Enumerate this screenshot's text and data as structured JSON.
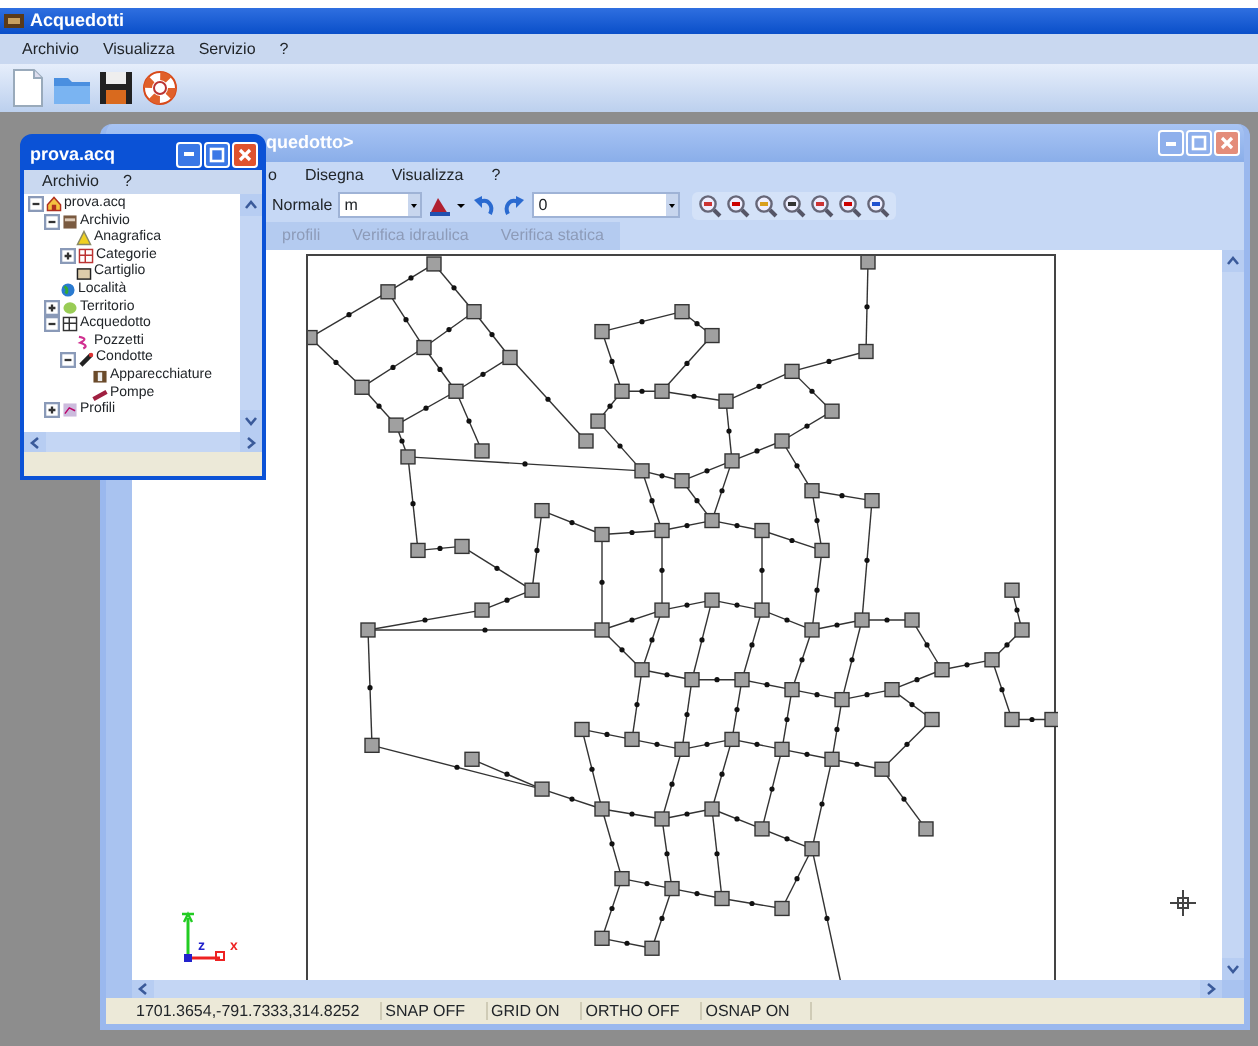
{
  "app": {
    "title": "Acquedotti",
    "menu": [
      "Archivio",
      "Visualizza",
      "Servizio",
      "?"
    ]
  },
  "project_window": {
    "title": "prova.acq",
    "menu": [
      "Archivio",
      "?"
    ],
    "tree": [
      {
        "label": "prova.acq",
        "expanded": true,
        "children": [
          {
            "label": "Archivio",
            "expanded": true,
            "children": [
              {
                "label": "Anagrafica"
              },
              {
                "label": "Categorie",
                "expanded": false
              },
              {
                "label": "Cartiglio"
              }
            ]
          },
          {
            "label": "Località"
          },
          {
            "label": "Territorio",
            "expanded": false
          },
          {
            "label": "Acquedotto",
            "expanded": true,
            "children": [
              {
                "label": "Pozzetti"
              },
              {
                "label": "Condotte",
                "expanded": true,
                "children": [
                  {
                    "label": "Apparecchiature"
                  },
                  {
                    "label": "Pompe"
                  }
                ]
              }
            ]
          },
          {
            "label": "Profili",
            "expanded": false
          }
        ]
      }
    ]
  },
  "drawing_window": {
    "title": "quedotto>",
    "menu": [
      "o",
      "Disegna",
      "Visualizza",
      "?"
    ],
    "toolbar": {
      "style_label": "Normale",
      "unit_value": "m",
      "layer_value": "0"
    },
    "tabs": [
      {
        "label": "profili",
        "disabled": true
      },
      {
        "label": "Verifica idraulica",
        "disabled": true
      },
      {
        "label": "Verifica statica",
        "disabled": true
      }
    ],
    "axis_labels": [
      "z",
      "x"
    ],
    "status_bar": [
      "1701.3654,-791.7333,314.8252",
      "SNAP OFF",
      "GRID ON",
      "ORTHO OFF",
      "OSNAP ON"
    ]
  }
}
